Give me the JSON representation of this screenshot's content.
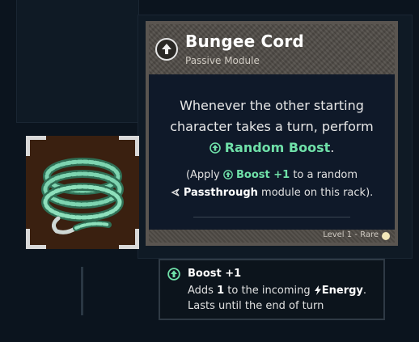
{
  "card": {
    "title": "Bungee Cord",
    "subtitle": "Passive Module",
    "desc_line1": "Whenever the other starting",
    "desc_line2": "character takes a turn, perform",
    "desc_keyword": "Random Boost",
    "desc_end": ".",
    "note_open": "(Apply ",
    "note_boost": "Boost +1",
    "note_mid": " to a random",
    "note_keyword": "Passthrough",
    "note_end": " module on this rack).",
    "level_rarity": "Level 1 - Rare",
    "rarity_color": "#f1e6b8"
  },
  "tooltip": {
    "title": "Boost +1",
    "line1_pre": "Adds ",
    "line1_num": "1",
    "line1_mid": " to the incoming ",
    "line1_keyword": "Energy",
    "line1_end": ".",
    "line2": "Lasts until the end of turn"
  },
  "item": {
    "icon": "coiled-rope-icon"
  },
  "colors": {
    "keyword_green": "#6fe0a8",
    "background": "#0b141e"
  }
}
